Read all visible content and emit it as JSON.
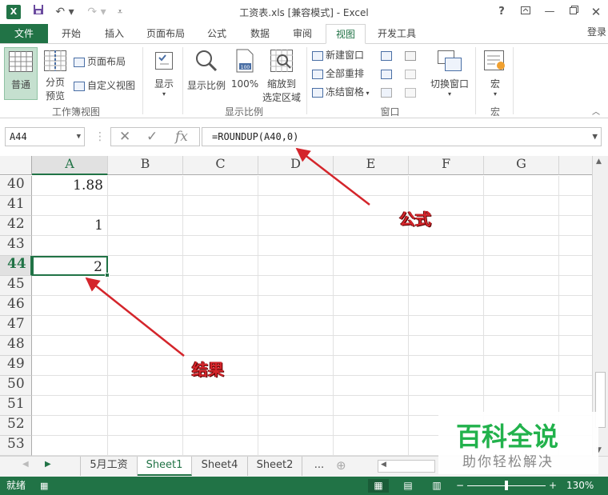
{
  "window": {
    "title": "工资表.xls  [兼容模式] - Excel",
    "help": "?",
    "login": "登录"
  },
  "ribbon_tabs": [
    {
      "label": "文件"
    },
    {
      "label": "开始"
    },
    {
      "label": "插入"
    },
    {
      "label": "页面布局"
    },
    {
      "label": "公式"
    },
    {
      "label": "数据"
    },
    {
      "label": "审阅"
    },
    {
      "label": "视图"
    },
    {
      "label": "开发工具"
    }
  ],
  "ribbon": {
    "normal": "普通",
    "page_break_line1": "分页",
    "page_break_line2": "预览",
    "page_layout": "页面布局",
    "custom_view": "自定义视图",
    "group_workbook_views": "工作簿视图",
    "show": "显示",
    "zoom": "显示比例",
    "zoom_100": "100%",
    "zoom_sel_line1": "缩放到",
    "zoom_sel_line2": "选定区域",
    "group_zoom": "显示比例",
    "new_window": "新建窗口",
    "arrange_all": "全部重排",
    "freeze_panes": "冻结窗格",
    "group_window": "窗口",
    "switch_windows": "切换窗口",
    "macros": "宏",
    "group_macros": "宏"
  },
  "formula_bar": {
    "name_box": "A44",
    "fx": "fx",
    "formula": "=ROUNDUP(A40,0)"
  },
  "columns": [
    "A",
    "B",
    "C",
    "D",
    "E",
    "F",
    "G"
  ],
  "rows": [
    {
      "num": "40",
      "a": "1.88"
    },
    {
      "num": "41",
      "a": ""
    },
    {
      "num": "42",
      "a": "1"
    },
    {
      "num": "43",
      "a": ""
    },
    {
      "num": "44",
      "a": "2"
    },
    {
      "num": "45",
      "a": ""
    },
    {
      "num": "46",
      "a": ""
    },
    {
      "num": "47",
      "a": ""
    },
    {
      "num": "48",
      "a": ""
    },
    {
      "num": "49",
      "a": ""
    },
    {
      "num": "50",
      "a": ""
    },
    {
      "num": "51",
      "a": ""
    },
    {
      "num": "52",
      "a": ""
    },
    {
      "num": "53",
      "a": ""
    }
  ],
  "sheet_tabs": [
    {
      "label": "5月工资"
    },
    {
      "label": "Sheet1"
    },
    {
      "label": "Sheet4"
    },
    {
      "label": "Sheet2"
    }
  ],
  "sheet_more": "...",
  "status": {
    "ready": "就绪",
    "zoom": "130%"
  },
  "annotations": {
    "formula_label": "公式",
    "result_label": "结果"
  },
  "watermark": {
    "title": "百科全说",
    "subtitle": "助你轻松解决"
  },
  "colors": {
    "excel_green": "#217346",
    "annotation_red": "#d4252b",
    "watermark_green": "#22b24c"
  }
}
